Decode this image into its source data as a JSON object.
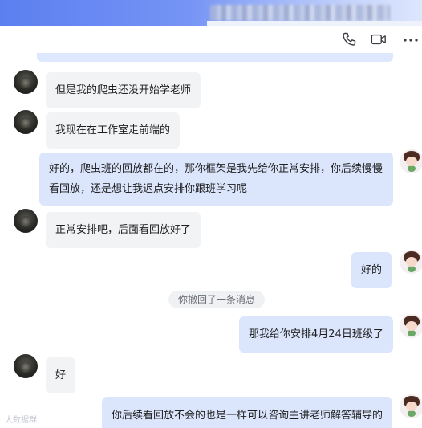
{
  "window": {
    "header_icons": [
      "phone-icon",
      "video-camera-icon",
      "more-icon"
    ]
  },
  "messages": [
    {
      "side": "left",
      "text": "但是我的爬虫还没开始学老师"
    },
    {
      "side": "left",
      "text": "我现在在工作室走前端的"
    },
    {
      "side": "right",
      "line1": "好的，爬虫班的回放都在的，那你框架是我先给你正常安排，你后续慢慢",
      "line2": "看回放，还是想让我迟点安排你跟班学习呢"
    },
    {
      "side": "left",
      "text": "正常安排吧，后面看回放好了"
    },
    {
      "side": "right",
      "text": "好的"
    },
    {
      "side": "right",
      "text": "那我给你安排4月24日班级了"
    },
    {
      "side": "left",
      "text": "好"
    },
    {
      "side": "right",
      "text": "你后续看回放不会的也是一样可以咨询主讲老师解答辅导的"
    }
  ],
  "system_notice": "你撤回了一条消息",
  "watermark": "大数据群",
  "colors": {
    "incoming_bubble": "#f2f3f5",
    "outgoing_bubble": "#dbe6fd",
    "topbar_accent": "#5b7ff0"
  }
}
